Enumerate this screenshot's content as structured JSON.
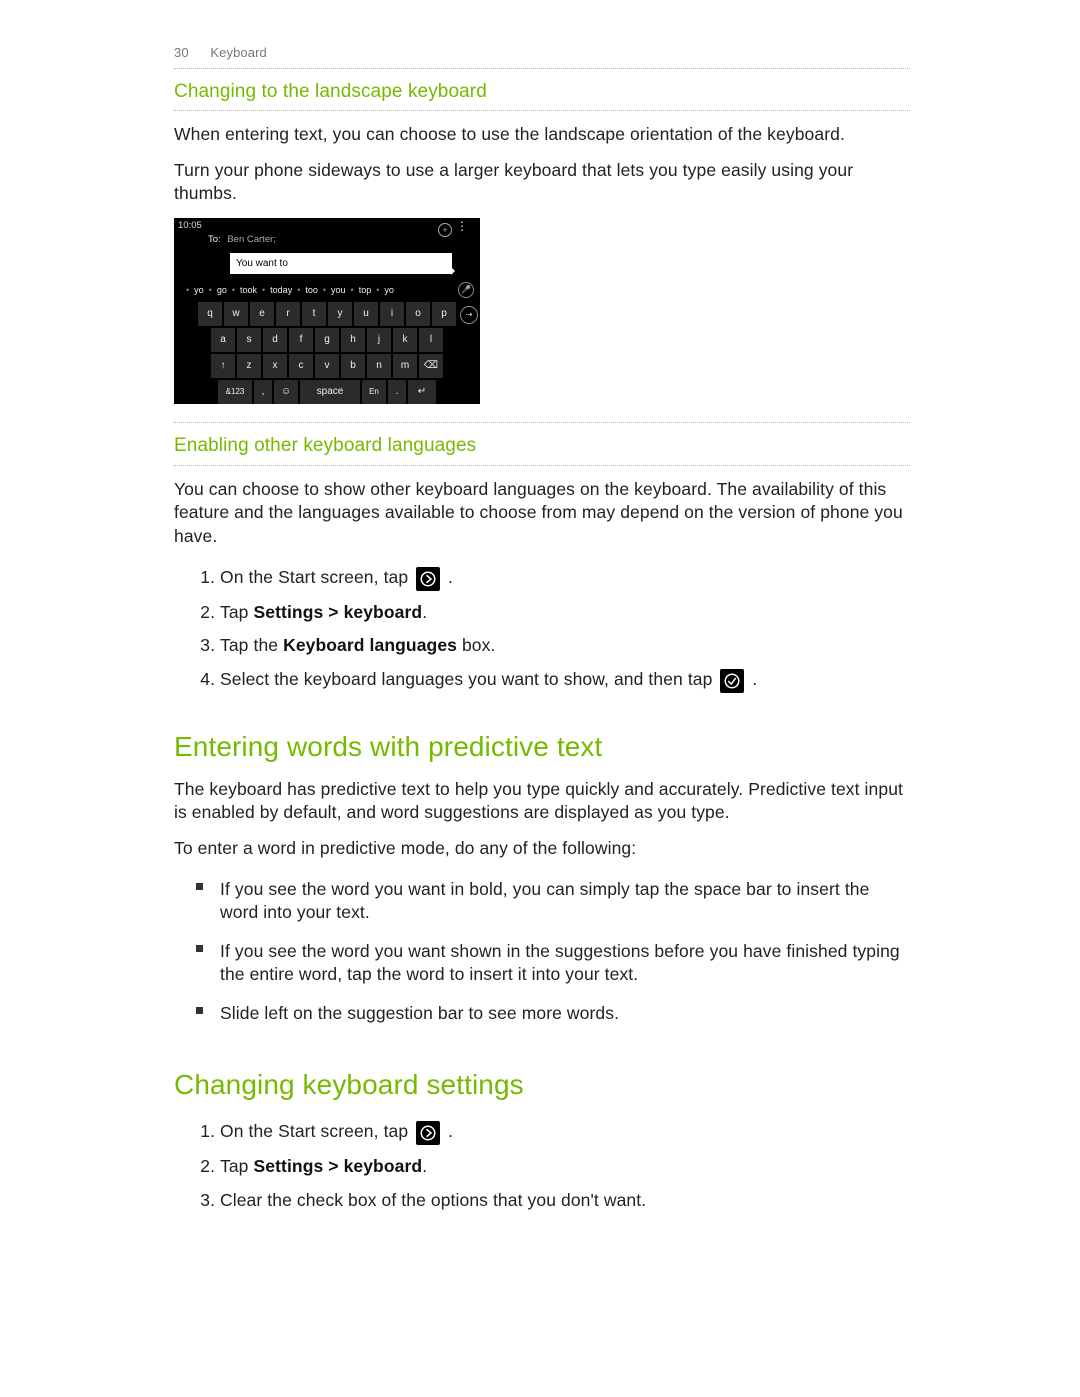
{
  "running_head": {
    "page_number": "30",
    "section": "Keyboard"
  },
  "section_landscape": {
    "heading": "Changing to the landscape keyboard",
    "p1": "When entering text, you can choose to use the landscape orientation of the keyboard.",
    "p2": "Turn your phone sideways to use a larger keyboard that lets you type easily using your thumbs."
  },
  "phone": {
    "time": "10:05",
    "to_label": "To:",
    "to_value": "Ben Carter;",
    "bubble_text": "You want to",
    "suggestions": [
      "yo",
      "go",
      "took",
      "today",
      "too",
      "you",
      "top",
      "yo"
    ],
    "rows": {
      "r1": [
        "q",
        "w",
        "e",
        "r",
        "t",
        "y",
        "u",
        "i",
        "o",
        "p"
      ],
      "r2": [
        "a",
        "s",
        "d",
        "f",
        "g",
        "h",
        "j",
        "k",
        "l"
      ],
      "r3_shift": "↑",
      "r3": [
        "z",
        "x",
        "c",
        "v",
        "b",
        "n",
        "m"
      ],
      "r3_back": "⌫",
      "r4_sym": "&123",
      "r4_comma": ",",
      "r4_emoji": "☺",
      "r4_space": "space",
      "r4_lang": "En",
      "r4_period": ".",
      "r4_enter": "↵"
    }
  },
  "section_languages": {
    "heading": "Enabling other keyboard languages",
    "intro": "You can choose to show other keyboard languages on the keyboard. The availability of this feature and the languages available to choose from may depend on the version of phone you have.",
    "step1_a": "On the Start screen, tap ",
    "step1_b": ".",
    "step2_a": "Tap ",
    "step2_bold": "Settings > keyboard",
    "step2_b": ".",
    "step3_a": "Tap the ",
    "step3_bold": "Keyboard languages",
    "step3_b": " box.",
    "step4_a": "Select the keyboard languages you want to show, and then tap ",
    "step4_b": "."
  },
  "section_predictive": {
    "heading": "Entering words with predictive text",
    "p1": "The keyboard has predictive text to help you type quickly and accurately. Predictive text input is enabled by default, and word suggestions are displayed as you type.",
    "p2": "To enter a word in predictive mode, do any of the following:",
    "b1": "If you see the word you want in bold, you can simply tap the space bar to insert the word into your text.",
    "b2": "If you see the word you want shown in the suggestions before you have finished typing the entire word, tap the word to insert it into your text.",
    "b3": "Slide left on the suggestion bar to see more words."
  },
  "section_settings": {
    "heading": "Changing keyboard settings",
    "step1_a": "On the Start screen, tap ",
    "step1_b": ".",
    "step2_a": "Tap ",
    "step2_bold": "Settings > keyboard",
    "step2_b": ".",
    "step3": "Clear the check box of the options that you don't want."
  }
}
